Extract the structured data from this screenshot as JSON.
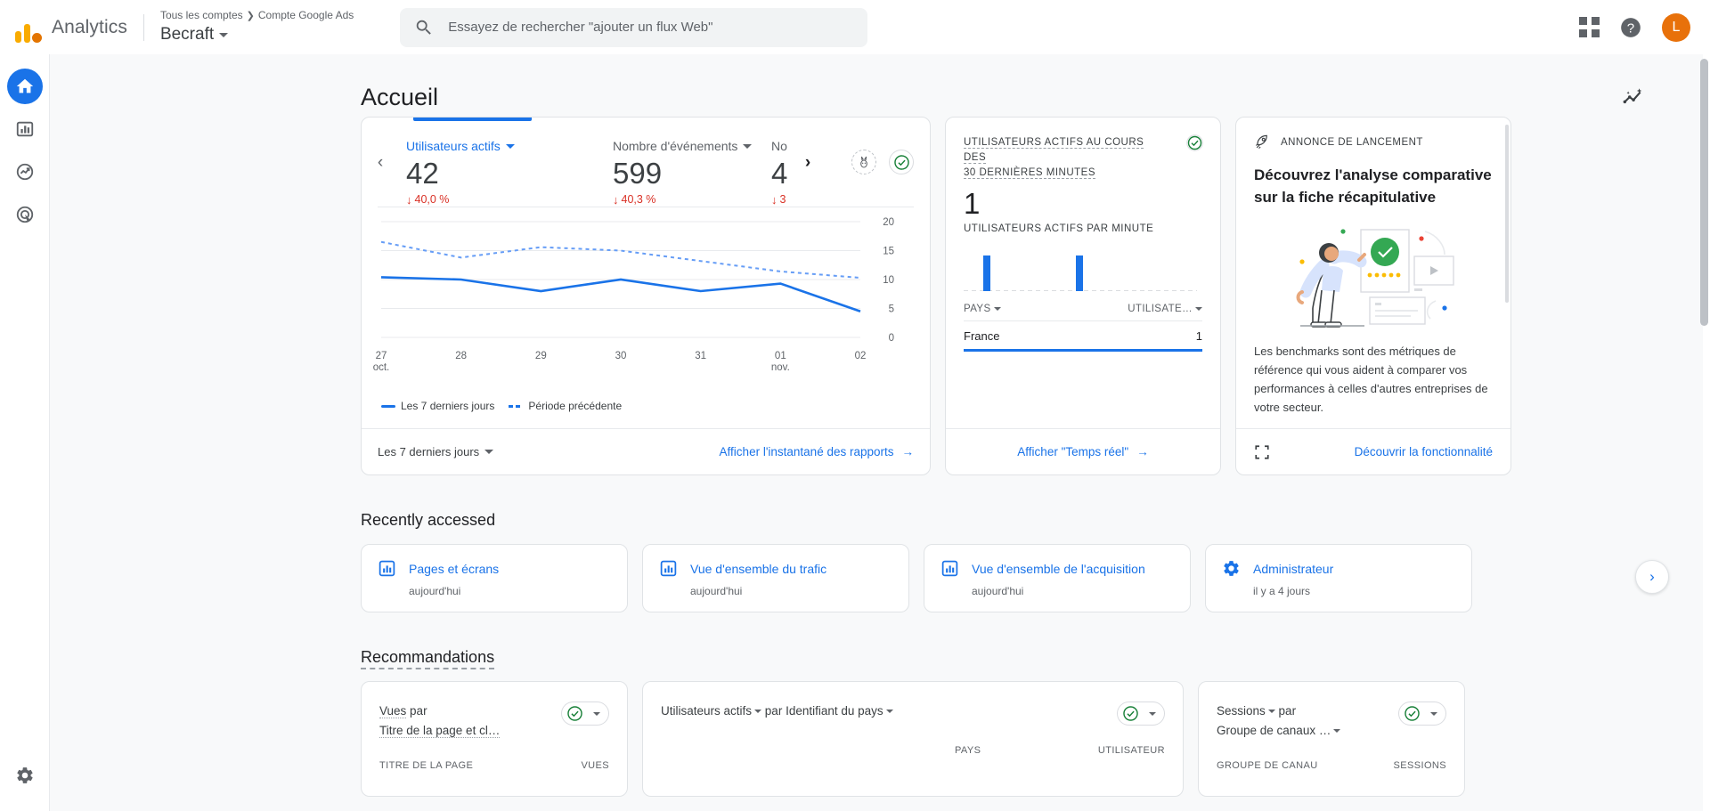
{
  "header": {
    "brand": "Analytics",
    "breadcrumb_root": "Tous les comptes",
    "breadcrumb_sep": "❯",
    "breadcrumb_account": "Compte Google Ads",
    "property_name": "Becraft",
    "search_placeholder": "Essayez de rechercher \"ajouter un flux Web\"",
    "avatar_initial": "L",
    "icons": {
      "search": "search-icon",
      "apps": "apps-grid-icon",
      "help": "help-icon"
    }
  },
  "sidebar": {
    "items": [
      {
        "name": "home",
        "label": "Accueil",
        "active": true
      },
      {
        "name": "reports",
        "label": "Rapports",
        "active": false
      },
      {
        "name": "explore",
        "label": "Explorer",
        "active": false
      },
      {
        "name": "advertising",
        "label": "Publicité",
        "active": false
      }
    ],
    "bottom": {
      "name": "admin",
      "label": "Administration"
    }
  },
  "page": {
    "title": "Accueil",
    "insights_icon": "insights-sparkle-icon"
  },
  "overview_card": {
    "metrics": [
      {
        "label": "Utilisateurs actifs",
        "value": "42",
        "delta": "40,0 %",
        "direction": "down",
        "selected": true
      },
      {
        "label": "Nombre d'événements",
        "value": "599",
        "delta": "40,3 %",
        "direction": "down",
        "selected": false
      },
      {
        "label": "No",
        "value": "4",
        "delta": "3",
        "direction": "down",
        "selected": false
      }
    ],
    "prev_arrow": "‹",
    "next_arrow": "›",
    "date_range": "Les 7 derniers jours",
    "footer_link": "Afficher l'instantané des rapports",
    "footer_arrow": "→",
    "legend": [
      {
        "label": "Les 7 derniers jours",
        "style": "solid"
      },
      {
        "label": "Période précédente",
        "style": "dashed"
      }
    ]
  },
  "chart_data": {
    "type": "line",
    "title": "Utilisateurs actifs",
    "xlabel": "",
    "ylabel": "",
    "ylim": [
      0,
      20
    ],
    "yticks": [
      0,
      5,
      10,
      15,
      20
    ],
    "grid": true,
    "legend_position": "bottom-left",
    "categories": [
      "27 oct.",
      "28",
      "29",
      "30",
      "31",
      "01 nov.",
      "02"
    ],
    "tick_labels": [
      {
        "day": "27",
        "month": "oct."
      },
      {
        "day": "28",
        "month": ""
      },
      {
        "day": "29",
        "month": ""
      },
      {
        "day": "30",
        "month": ""
      },
      {
        "day": "31",
        "month": ""
      },
      {
        "day": "01",
        "month": "nov."
      },
      {
        "day": "02",
        "month": ""
      }
    ],
    "series": [
      {
        "name": "Les 7 derniers jours",
        "style": "solid",
        "color": "#1a73e8",
        "values": [
          10.4,
          10,
          8,
          10,
          8,
          9.3,
          4.5
        ]
      },
      {
        "name": "Période précédente",
        "style": "dashed",
        "color": "#669df6",
        "values": [
          16.5,
          13.8,
          15.6,
          15,
          13.2,
          11.4,
          10.3
        ]
      }
    ]
  },
  "realtime_card": {
    "title_line1": "Utilisateurs actifs au cours des",
    "title_line2": "30 dernières minutes",
    "value": "1",
    "subtitle": "Utilisateurs actifs par minute",
    "spark_values": [
      0,
      1,
      0,
      0,
      0,
      0,
      0,
      0,
      0,
      1,
      0,
      0,
      0,
      0,
      0,
      0,
      0,
      0,
      0,
      0,
      0,
      0,
      0,
      0,
      0,
      0,
      0,
      0,
      0,
      0
    ],
    "table": {
      "columns": [
        "Pays",
        "Utilisate…"
      ],
      "rows": [
        {
          "country": "France",
          "users": "1"
        }
      ]
    },
    "footer_link": "Afficher \"Temps réel\"",
    "footer_arrow": "→"
  },
  "announcement_card": {
    "kicker": "Annonce de lancement",
    "kicker_icon": "rocket-icon",
    "title": "Découvrez l'analyse comparative sur la fiche récapitulative",
    "illustration": "benchmark-illustration",
    "body": "Les benchmarks sont des métriques de référence qui vous aident à comparer vos performances à celles d'autres entreprises de votre secteur.",
    "expand_icon": "expand-icon",
    "footer_link": "Découvrir la fonctionnalité"
  },
  "recently_accessed": {
    "heading": "Recently accessed",
    "next_arrow": "›",
    "items": [
      {
        "icon": "bar-chart-icon",
        "name": "Pages et écrans",
        "time": "aujourd'hui"
      },
      {
        "icon": "bar-chart-icon",
        "name": "Vue d'ensemble du trafic",
        "time": "aujourd'hui"
      },
      {
        "icon": "bar-chart-icon",
        "name": "Vue d'ensemble de l'acquisition",
        "time": "aujourd'hui"
      },
      {
        "icon": "gear-icon",
        "name": "Administrateur",
        "time": "il y a 4 jours"
      }
    ]
  },
  "recommendations": {
    "heading": "Recommandations",
    "cards": [
      {
        "metric": "Vues",
        "by": "par",
        "dimension": "Titre de la page et cl…",
        "layout": "stacked",
        "col_left": "Titre de la page",
        "col_right": "Vues"
      },
      {
        "metric": "Utilisateurs actifs",
        "by": "par",
        "dimension": "Identifiant du pays",
        "layout": "inline",
        "col_left": "Pays",
        "col_right": "Utilisateur"
      },
      {
        "metric": "Sessions",
        "by": "par",
        "dimension": "Groupe de canaux …",
        "layout": "stacked",
        "col_left": "Groupe de canau",
        "col_right": "Sessions"
      }
    ]
  },
  "colors": {
    "brand_orange": "#e8710a",
    "accent_blue": "#1a73e8",
    "light_blue": "#669df6",
    "negative_red": "#d93025",
    "success_green": "#188038",
    "page_bg": "#f8f9fa"
  }
}
